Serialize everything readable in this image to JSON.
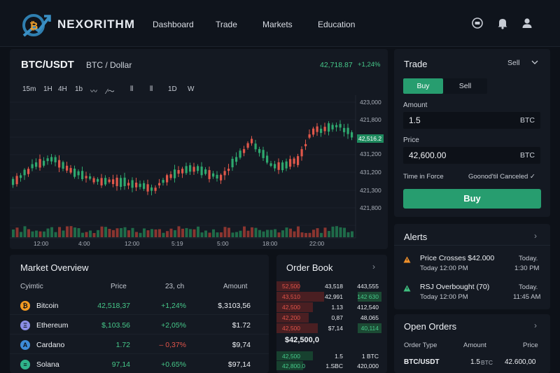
{
  "brand": {
    "name": "NEXORITHM"
  },
  "nav": [
    "Dashboard",
    "Trade",
    "Markets",
    "Education"
  ],
  "header_icons": [
    "chat-icon",
    "bell-icon",
    "user-icon"
  ],
  "chart": {
    "pair": "BTC/USDT",
    "pair_sub": "BTC / Dollar",
    "last_price": "42,718.87",
    "last_change": "+1,24%",
    "timeframes": [
      "15m",
      "1H",
      "4H",
      "1b",
      "〰",
      "⁄〜",
      "⫴",
      "⫴",
      "1D",
      "W"
    ],
    "price_axis": [
      "423,000",
      "421,800",
      "431,200",
      "431,200",
      "421,300",
      "421,800"
    ],
    "current_price_tag": "42,516.2",
    "time_axis": [
      "12:00",
      "4:00",
      "12:00",
      "5:19",
      "5:00",
      "18:00",
      "22:00"
    ]
  },
  "trade": {
    "title": "Trade",
    "side_dropdown": "Sell",
    "buy_tab": "Buy",
    "sell_tab": "Sell",
    "amount_label": "Amount",
    "amount_value": "1.5",
    "amount_unit": "BTC",
    "price_label": "Price",
    "price_value": "42,600.00",
    "price_unit": "BTC",
    "tif_label": "Time in Force",
    "tif_value": "Goonod'til Canceled",
    "buy_button": "Buy"
  },
  "alerts": {
    "title": "Alerts",
    "items": [
      {
        "title": "Price Crosses $42.000",
        "sub": "Today  12:00 PM",
        "right1": "Today.",
        "right2": "1:30 PM",
        "color": "#f0902a"
      },
      {
        "title": "RSJ Overbought (70)",
        "sub": "Today  12:00 PM",
        "right1": "Today.",
        "right2": "11:45 AM",
        "color": "#3fbf7f"
      }
    ]
  },
  "open_orders": {
    "title": "Open Orders",
    "headers": [
      "Order Type",
      "Amount",
      "Price"
    ],
    "rows": [
      {
        "type": "BTC/USDT",
        "amount": "1.5",
        "unit": "BTC",
        "price": "42.600,00"
      }
    ]
  },
  "market": {
    "title": "Market Overview",
    "headers": [
      "Cyimtic",
      "Price",
      "23, ch",
      "Amount"
    ],
    "rows": [
      {
        "name": "Bitcoin",
        "price": "42,518,37",
        "change": "+1,24%",
        "amount": "$,3103,56",
        "color": "#f39a22",
        "glyph": "₿",
        "up": true
      },
      {
        "name": "Ethereum",
        "price": "$,103.56",
        "change": "+2,05%",
        "amount": "$1.72",
        "color": "#8b8ee6",
        "glyph": "Ξ",
        "up": true
      },
      {
        "name": "Cardano",
        "price": "1.72",
        "change": "– 0,37%",
        "amount": "$9,74",
        "color": "#3d8bd8",
        "glyph": "A",
        "up": false
      },
      {
        "name": "Solana",
        "price": "97,14",
        "change": "+0.65%",
        "amount": "$97,14",
        "color": "#2fb38a",
        "glyph": "≡",
        "up": true
      }
    ]
  },
  "orderbook": {
    "title": "Order Book",
    "asks": [
      {
        "price": "52,500",
        "size": "43,518",
        "total": "443,555"
      },
      {
        "price": "43,510",
        "size": "42,991",
        "total": "142 630"
      },
      {
        "price": "42,500",
        "size": "1.13",
        "total": "412,540"
      },
      {
        "price": "42,200",
        "size": "0,87",
        "total": "48,065"
      },
      {
        "price": "42,500",
        "size": "$7,14",
        "total": "40,114"
      }
    ],
    "mid": "$42,500,0",
    "bids": [
      {
        "price": "42,500",
        "size": "1.5",
        "total": "1 BTC"
      },
      {
        "price": "42,800.0",
        "size": "1.SBC",
        "total": "420,000"
      }
    ]
  }
}
